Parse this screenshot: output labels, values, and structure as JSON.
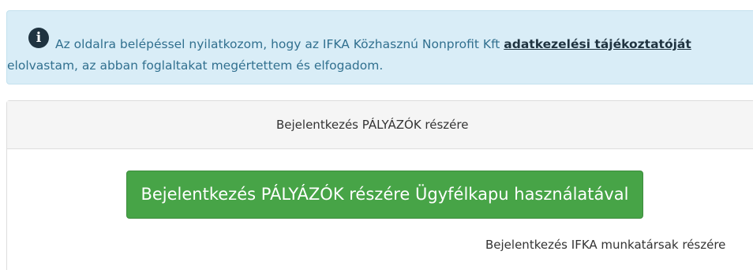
{
  "alert": {
    "icon": "info-circle-icon",
    "text_before_link": "Az oldalra belépéssel nyilatkozom, hogy az IFKA Közhasznú Nonprofit Kft ",
    "link_text": "adatkezelési tájékoztatóját",
    "text_line2": "elolvastam, az abban foglaltakat megértettem és elfogadom."
  },
  "panel": {
    "heading": "Bejelentkezés PÁLYÁZÓK részére",
    "primary_button_label": "Bejelentkezés PÁLYÁZÓK részére Ügyfélkapu használatával",
    "staff_link_label": "Bejelentkezés IFKA munkatársak részére"
  },
  "colors": {
    "alert_background": "#d9edf7",
    "alert_text": "#31708f",
    "button_green": "#47a447",
    "panel_heading_bg": "#f5f5f5"
  }
}
